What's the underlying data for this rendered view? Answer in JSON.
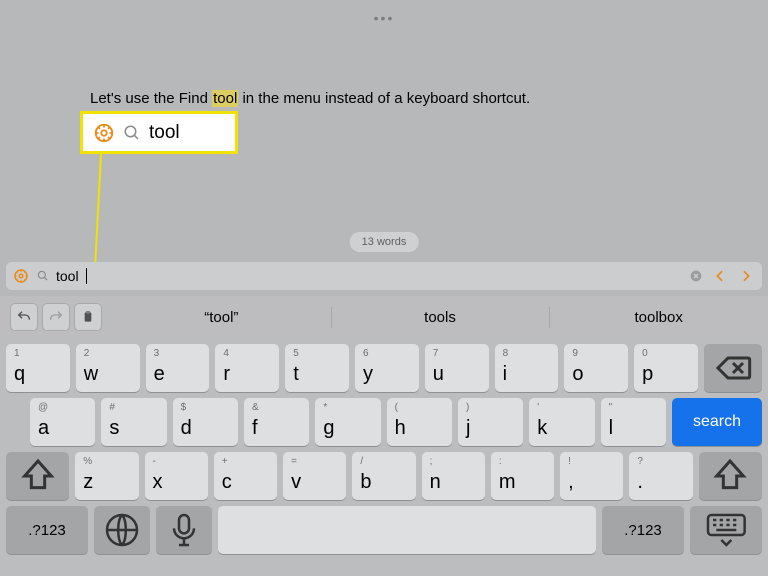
{
  "document": {
    "text_before": "Let's use the Find",
    "highlighted": "tool",
    "text_after": "in the menu instead of a keyboard shortcut."
  },
  "callout": {
    "query": "tool"
  },
  "wordcount": "13 words",
  "findbar": {
    "query": "tool"
  },
  "suggestions": {
    "s1": "“tool”",
    "s2": "tools",
    "s3": "toolbox"
  },
  "keyboard": {
    "row1": [
      {
        "sub": "1",
        "main": "q"
      },
      {
        "sub": "2",
        "main": "w"
      },
      {
        "sub": "3",
        "main": "e"
      },
      {
        "sub": "4",
        "main": "r"
      },
      {
        "sub": "5",
        "main": "t"
      },
      {
        "sub": "6",
        "main": "y"
      },
      {
        "sub": "7",
        "main": "u"
      },
      {
        "sub": "8",
        "main": "i"
      },
      {
        "sub": "9",
        "main": "o"
      },
      {
        "sub": "0",
        "main": "p"
      }
    ],
    "row2": [
      {
        "sub": "@",
        "main": "a"
      },
      {
        "sub": "#",
        "main": "s"
      },
      {
        "sub": "$",
        "main": "d"
      },
      {
        "sub": "&",
        "main": "f"
      },
      {
        "sub": "*",
        "main": "g"
      },
      {
        "sub": "(",
        "main": "h"
      },
      {
        "sub": ")",
        "main": "j"
      },
      {
        "sub": "'",
        "main": "k"
      },
      {
        "sub": "\"",
        "main": "l"
      }
    ],
    "search_label": "search",
    "row3": [
      {
        "sub": "%",
        "main": "z"
      },
      {
        "sub": "-",
        "main": "x"
      },
      {
        "sub": "+",
        "main": "c"
      },
      {
        "sub": "=",
        "main": "v"
      },
      {
        "sub": "/",
        "main": "b"
      },
      {
        "sub": ";",
        "main": "n"
      },
      {
        "sub": ":",
        "main": "m"
      },
      {
        "sub": "!",
        "main": ","
      },
      {
        "sub": "?",
        "main": "."
      }
    ],
    "numkey": ".?123"
  }
}
